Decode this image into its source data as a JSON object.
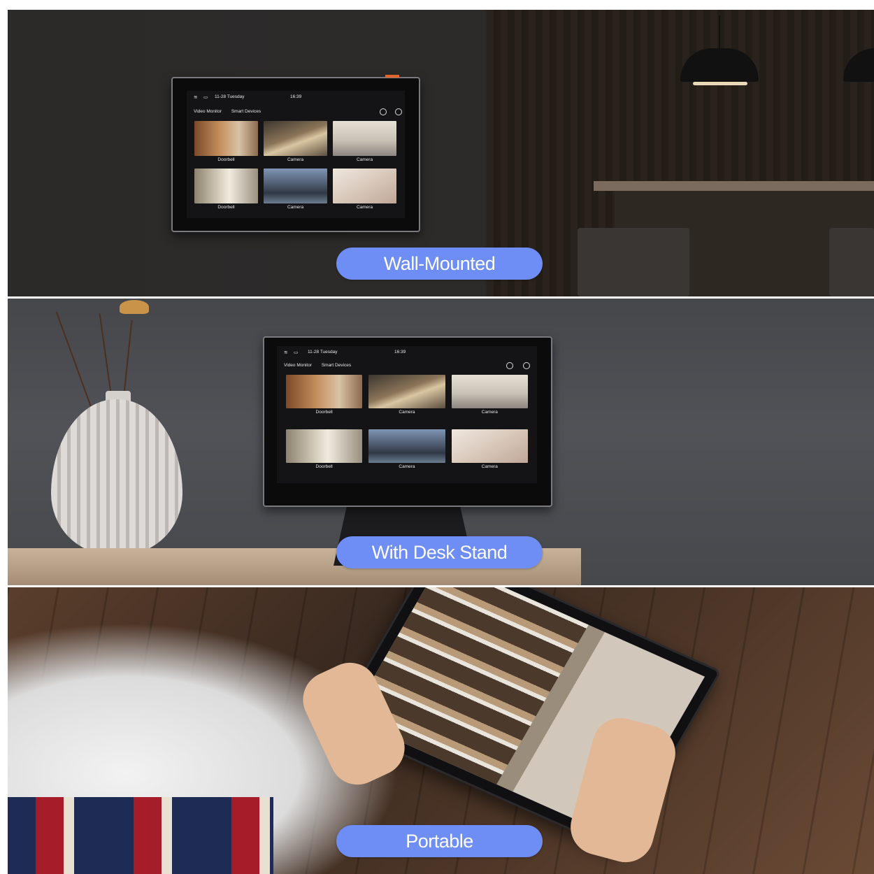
{
  "labels": {
    "wall": "Wall-Mounted",
    "desk": "With Desk Stand",
    "portable": "Portable"
  },
  "screen_ui": {
    "date": "11-28 Tuesday",
    "time": "16:39",
    "tabs": [
      "Video Monitor",
      "Smart Devices"
    ],
    "tiles": [
      "Doorbell",
      "Camera",
      "Camera",
      "Doorbell",
      "Camera",
      "Camera"
    ]
  },
  "colors": {
    "pill": "#6e8ef5",
    "pill_text": "#ffffff"
  },
  "icons": [
    "wifi-icon",
    "battery-icon",
    "refresh-icon",
    "settings-icon"
  ]
}
